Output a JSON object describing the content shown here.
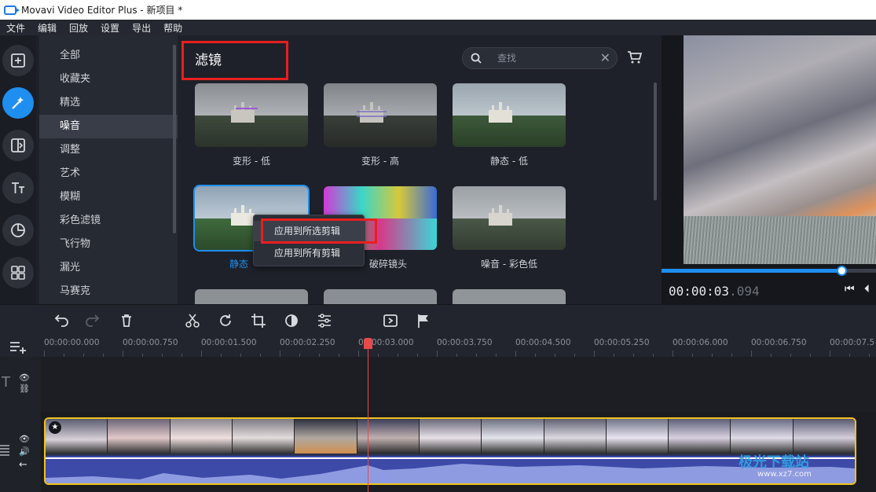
{
  "window": {
    "title": "Movavi Video Editor Plus - 新项目 *"
  },
  "menu": [
    "文件",
    "编辑",
    "回放",
    "设置",
    "导出",
    "帮助"
  ],
  "rail_icons": [
    "import-icon",
    "filters-icon",
    "transitions-icon",
    "titles-icon",
    "stickers-icon",
    "more-tools-icon"
  ],
  "categories": [
    "全部",
    "收藏夹",
    "精选",
    "噪音",
    "调整",
    "艺术",
    "模糊",
    "彩色滤镜",
    "飞行物",
    "漏光",
    "马赛克"
  ],
  "active_category": "噪音",
  "panel": {
    "title": "滤镜",
    "search_placeholder": "查找",
    "clear": "✕"
  },
  "filters": [
    {
      "label": "变形 - 低"
    },
    {
      "label": "变形 - 高"
    },
    {
      "label": "静态 - 低"
    },
    {
      "label": "静态"
    },
    {
      "label": "破碎镜头"
    },
    {
      "label": "噪音 - 彩色低"
    }
  ],
  "context_menu": {
    "apply_selected": "应用到所选剪辑",
    "apply_all": "应用到所有剪辑"
  },
  "preview": {
    "timecode_main": "00:00:03",
    "timecode_ms": ".094",
    "progress": 0.84
  },
  "ruler": [
    "00:00:00.000",
    "00:00:00.750",
    "00:00:01.500",
    "00:00:02.250",
    "00:00:03.000",
    "00:00:03.750",
    "00:00:04.500",
    "00:00:05.250",
    "00:00:06.000",
    "00:00:06.750",
    "00:00:07.5"
  ],
  "track_heads": {
    "title_track": "T"
  },
  "watermark": {
    "main": "极光下载站",
    "sub": "www.xz7.com"
  },
  "colors": {
    "accent": "#1e8ef0",
    "highlight": "#e81f1f",
    "clip_border": "#f0c21a"
  }
}
